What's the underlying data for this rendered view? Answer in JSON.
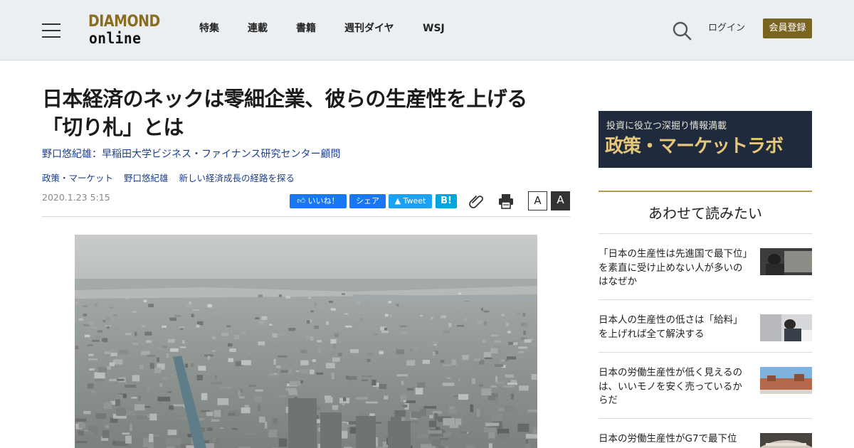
{
  "header": {
    "logo_line1": "DIAMOND",
    "logo_line2": "online",
    "nav": [
      "特集",
      "連載",
      "書籍",
      "週刊ダイヤ",
      "WSJ"
    ],
    "login": "ログイン",
    "register": "会員登録"
  },
  "article": {
    "title_line1": "日本経済のネックは零細企業、彼らの生産性を上げる",
    "title_line2": "「切り札」とは",
    "author": "野口悠紀雄：早稲田大学ビジネス・ファイナンス研究センター顧問",
    "tags": [
      "政策・マーケット",
      "野口悠紀雄",
      "新しい経済成長の経路を探る"
    ],
    "date": "2020.1.23 5:15",
    "share": {
      "like": "いいね！",
      "share": "シェア",
      "tweet": "Tweet",
      "hatena": "B!"
    },
    "font_small": "A",
    "font_large": "A"
  },
  "sidebar": {
    "banner_line1": "投資に役立つ深掘り情報満載",
    "banner_line2": "政策・マーケットラボ",
    "heading": "あわせて読みたい",
    "items": [
      {
        "title": "「日本の生産性は先進国で最下位」を素直に受け止めない人が多いのはなぜか"
      },
      {
        "title": "日本人の生産性の低さは「給料」を上げれば全て解決する"
      },
      {
        "title": "日本の労働生産性が低く見えるのは、いいモノを安く売っているからだ"
      },
      {
        "title": "日本の労働生産性がG7で最下位"
      }
    ]
  },
  "colors": {
    "brand_gold": "#7a6420",
    "link_blue": "#1a3e93",
    "facebook": "#1877f2",
    "twitter": "#1da1f2",
    "hatena": "#00a4de"
  }
}
